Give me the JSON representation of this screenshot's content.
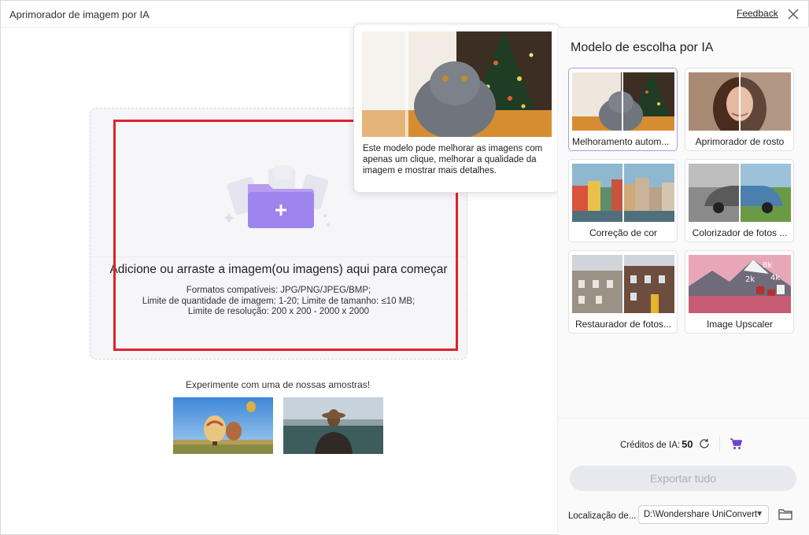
{
  "window": {
    "title": "Aprimorador de imagem por IA",
    "feedback_label": "Feedback",
    "close_icon": "close-icon"
  },
  "dropzone": {
    "title": "Adicione ou arraste a imagem(ou imagens) aqui para começar",
    "formats": "Formatos compatíveis: JPG/PNG/JPEG/BMP;",
    "limits": "Limite de quantidade de imagem: 1-20; Limite de tamanho: ≤10 MB;",
    "resolution": "Limite de resolução: 200 x 200 - 2000 x 2000",
    "icon": "folder-add-icon"
  },
  "samples": {
    "label": "Experimente com uma de nossas amostras!",
    "items": [
      "hot-air-balloons",
      "woman-with-hat-landscape"
    ]
  },
  "tooltip": {
    "text": "Este modelo pode melhorar as imagens com apenas um clique, melhorar a qualidade da imagem e mostrar mais detalhes."
  },
  "panel": {
    "title": "Modelo de escolha por IA",
    "models": [
      {
        "label": "Melhoramento autom...",
        "selected": true
      },
      {
        "label": "Aprimorador de rosto",
        "selected": false
      },
      {
        "label": "Correção de cor",
        "selected": false
      },
      {
        "label": "Colorizador de fotos ...",
        "selected": false
      },
      {
        "label": "Restaurador de fotos...",
        "selected": false
      },
      {
        "label": "Image Upscaler",
        "selected": false
      }
    ],
    "credits_label": "Créditos de IA:",
    "credits_value": "50",
    "export_label": "Exportar tudo",
    "location_label": "Localização de...",
    "location_value": "D:\\Wondershare UniConvert"
  },
  "colors": {
    "highlight": "#e0222b",
    "accent": "#7b5cf0",
    "selected_border": "#a99be8"
  }
}
